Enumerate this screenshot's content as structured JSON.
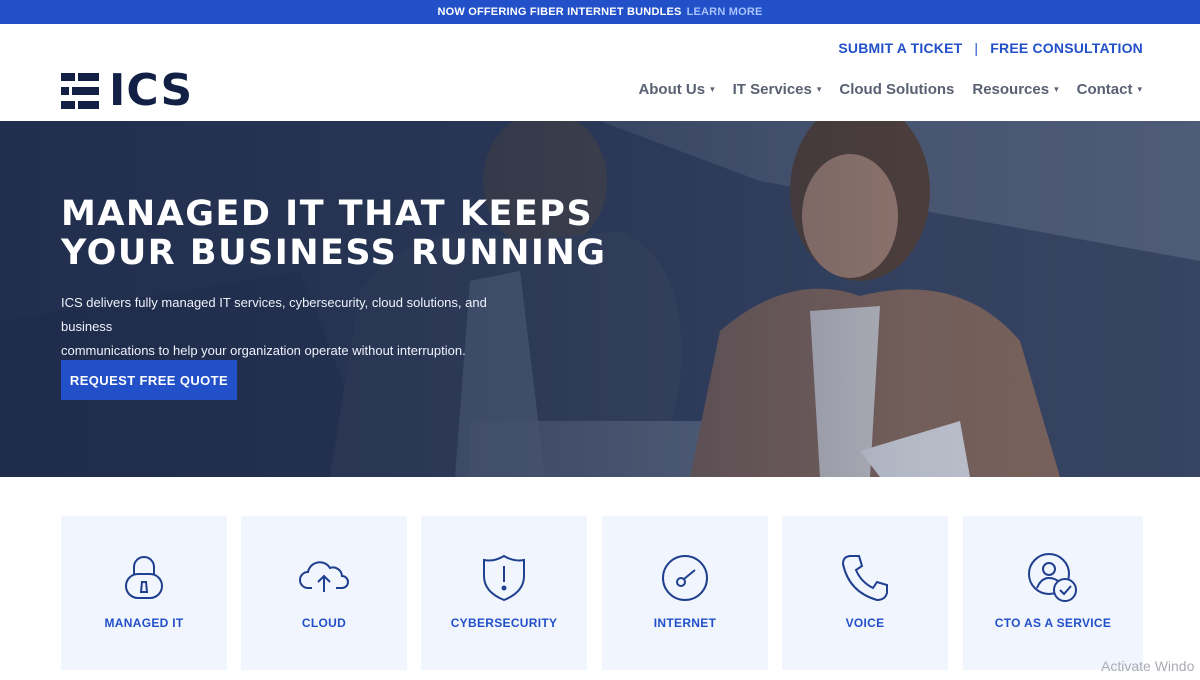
{
  "announcement": {
    "text": "NOW OFFERING FIBER INTERNET BUNDLES",
    "link": "LEARN MORE"
  },
  "header": {
    "logo_text": "ICS",
    "utility_links": [
      "SUBMIT A TICKET",
      "FREE CONSULTATION"
    ],
    "separator": "|",
    "nav": [
      {
        "label": "About Us",
        "has_dropdown": true
      },
      {
        "label": "IT Services",
        "has_dropdown": true
      },
      {
        "label": "Cloud Solutions",
        "has_dropdown": false
      },
      {
        "label": "Resources",
        "has_dropdown": true
      },
      {
        "label": "Contact",
        "has_dropdown": true
      }
    ],
    "chevron": "⌄"
  },
  "hero": {
    "title_line1": "MANAGED IT THAT KEEPS",
    "title_line2": "YOUR BUSINESS RUNNING",
    "subtitle_line1": "ICS delivers fully managed IT services, cybersecurity, cloud solutions, and business",
    "subtitle_line2": "communications to help your organization operate without interruption.",
    "cta": "REQUEST FREE QUOTE"
  },
  "services": [
    {
      "label": "MANAGED IT",
      "icon": "lock-icon"
    },
    {
      "label": "CLOUD",
      "icon": "cloud-upload-icon"
    },
    {
      "label": "CYBERSECURITY",
      "icon": "shield-alert-icon"
    },
    {
      "label": "INTERNET",
      "icon": "speedometer-icon"
    },
    {
      "label": "VOICE",
      "icon": "phone-icon"
    },
    {
      "label": "CTO AS A SERVICE",
      "icon": "user-check-icon"
    }
  ],
  "os_watermark": "Activate Windo",
  "colors": {
    "brand_blue": "#2150c9",
    "navy": "#132045",
    "card_bg": "#f1f5fd",
    "nav_gray": "#5a6172"
  }
}
